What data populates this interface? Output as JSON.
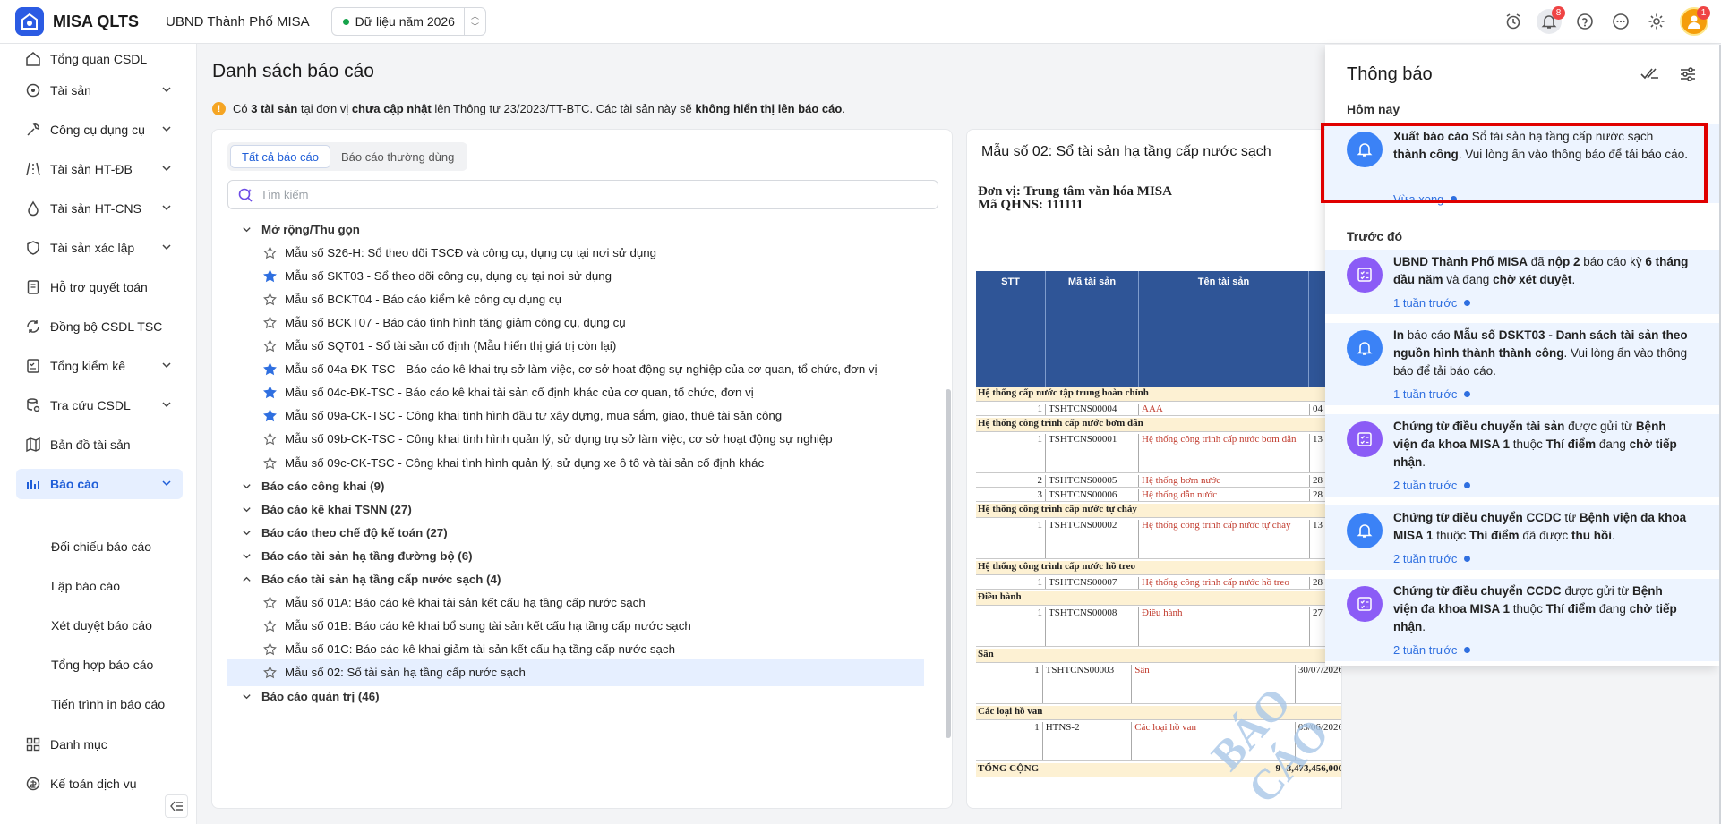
{
  "app": {
    "name": "MISA QLTS",
    "org": "UBND Thành Phố MISA",
    "year_label": "Dữ liệu năm 2026"
  },
  "topbar": {
    "notif_count": "8",
    "avatar_count": "1"
  },
  "sidebar": {
    "items": [
      {
        "label": "Tổng quan CSDL",
        "icon": "home-icon"
      },
      {
        "label": "Tài sản",
        "icon": "assets-icon"
      },
      {
        "label": "Công cụ dụng cụ",
        "icon": "tools-icon"
      },
      {
        "label": "Tài sản HT-ĐB",
        "icon": "road-icon"
      },
      {
        "label": "Tài sản HT-CNS",
        "icon": "water-icon"
      },
      {
        "label": "Tài sản xác lập",
        "icon": "shield-icon"
      },
      {
        "label": "Hỗ trợ quyết toán",
        "icon": "doc-icon"
      },
      {
        "label": "Đồng bộ CSDL TSC",
        "icon": "sync-icon"
      },
      {
        "label": "Tổng kiểm kê",
        "icon": "checklist-icon"
      },
      {
        "label": "Tra cứu CSDL",
        "icon": "search-db-icon"
      },
      {
        "label": "Bản đồ tài sản",
        "icon": "map-icon"
      },
      {
        "label": "Báo cáo",
        "icon": "report-icon"
      }
    ],
    "sub_items": [
      "Đối chiếu báo cáo",
      "Lập báo cáo",
      "Xét duyệt báo cáo",
      "Tổng hợp báo cáo",
      "Tiến trình in báo cáo"
    ],
    "bottom_items": [
      {
        "label": "Danh mục",
        "icon": "grid-icon"
      },
      {
        "label": "Kế toán dịch vụ",
        "icon": "accounting-icon"
      }
    ]
  },
  "main": {
    "title": "Danh sách báo cáo",
    "warning": {
      "a": "Có ",
      "b": "3 tài sản",
      "c": " tại đơn vị ",
      "d": "chưa cập nhật",
      "e": " lên Thông tư 23/2023/TT-BTC. Các tài sản này sẽ ",
      "f": "không hiển thị lên báo cáo",
      "g": "."
    },
    "tabs": [
      "Tất cả báo cáo",
      "Báo cáo thường dùng"
    ],
    "search_placeholder": "Tìm kiếm",
    "tree": [
      {
        "type": "group",
        "label": "Mở rộng/Thu gọn",
        "open": true
      },
      {
        "type": "leaf",
        "label": "Mẫu số S26-H: Sổ theo dõi TSCĐ và công cụ, dụng cụ tại nơi sử dụng",
        "starred": false
      },
      {
        "type": "leaf",
        "label": "Mẫu số SKT03 - Sổ theo dõi công cụ, dụng cụ tại nơi sử dụng",
        "starred": true
      },
      {
        "type": "leaf",
        "label": "Mẫu số BCKT04 - Báo cáo kiểm kê công cụ dụng cụ",
        "starred": false
      },
      {
        "type": "leaf",
        "label": "Mẫu số BCKT07 - Báo cáo tình hình tăng giảm công cụ, dụng cụ",
        "starred": false
      },
      {
        "type": "leaf",
        "label": "Mẫu số SQT01 - Sổ tài sản cố định (Mẫu hiển thị giá trị còn lại)",
        "starred": false
      },
      {
        "type": "leaf",
        "label": "Mẫu số 04a-ĐK-TSC - Báo cáo kê khai trụ sở làm việc, cơ sở hoạt động sự nghiệp của cơ quan, tổ chức, đơn vị",
        "starred": true
      },
      {
        "type": "leaf",
        "label": "Mẫu số 04c-ĐK-TSC - Báo cáo kê khai tài sản cố định khác của cơ quan, tổ chức, đơn vị",
        "starred": true
      },
      {
        "type": "leaf",
        "label": "Mẫu số 09a-CK-TSC - Công khai tình hình đầu tư xây dựng, mua sắm, giao, thuê tài sản công",
        "starred": true
      },
      {
        "type": "leaf",
        "label": "Mẫu số 09b-CK-TSC - Công khai tình hình quản lý, sử dụng trụ sở làm việc, cơ sở hoạt động sự nghiệp",
        "starred": false
      },
      {
        "type": "leaf",
        "label": "Mẫu số 09c-CK-TSC - Công khai tình hình quản lý, sử dụng xe ô tô và tài sản cố định khác",
        "starred": false
      },
      {
        "type": "group",
        "label": "Báo cáo công khai (9)",
        "open": false
      },
      {
        "type": "group",
        "label": "Báo cáo kê khai TSNN (27)",
        "open": false
      },
      {
        "type": "group",
        "label": "Báo cáo theo chế độ kế toán (27)",
        "open": false
      },
      {
        "type": "group",
        "label": "Báo cáo tài sản hạ tầng đường bộ (6)",
        "open": false
      },
      {
        "type": "group",
        "label": "Báo cáo tài sản hạ tầng cấp nước sạch (4)",
        "open": true
      },
      {
        "type": "leaf",
        "label": "Mẫu số 01A: Báo cáo kê khai tài sản kết cấu hạ tầng cấp nước sạch",
        "starred": false
      },
      {
        "type": "leaf",
        "label": "Mẫu số 01B: Báo cáo kê khai bổ sung tài sản kết cấu hạ tầng cấp nước sạch",
        "starred": false
      },
      {
        "type": "leaf",
        "label": "Mẫu số 01C: Báo cáo kê khai giảm tài sản kết cấu hạ tầng cấp nước sạch",
        "starred": false
      },
      {
        "type": "leaf",
        "label": "Mẫu số 02: Sổ tài sản hạ tầng cấp nước sạch",
        "starred": false,
        "selected": true
      },
      {
        "type": "group",
        "label": "Báo cáo quản trị (46)",
        "open": false
      }
    ]
  },
  "preview": {
    "title": "Mẫu số 02: Sổ tài sản hạ tầng cấp nước sạch",
    "unit_line1": "Đơn vị: Trung tâm văn hóa MISA",
    "unit_line2": "Mã QHNS: 111111",
    "headers": [
      "STT",
      "Mã tài sản",
      "Tên tài sản"
    ],
    "rows": [
      {
        "g": true,
        "t": "Hệ thống cấp nước tập trung hoàn chỉnh"
      },
      {
        "g": false,
        "stt": "1",
        "code": "TSHTCNS00004",
        "name": "AAA",
        "extra": "04"
      },
      {
        "g": true,
        "t": "Hệ thống công trình cấp nước bơm dẫn"
      },
      {
        "g": false,
        "stt": "1",
        "code": "TSHTCNS00001",
        "name": "Hệ thống công trình cấp nước bơm dẫn",
        "extra": "13",
        "tall": true
      },
      {
        "g": false,
        "stt": "2",
        "code": "TSHTCNS00005",
        "name": "Hệ thống bơm nước",
        "extra": "28"
      },
      {
        "g": false,
        "stt": "3",
        "code": "TSHTCNS00006",
        "name": "Hệ thống dẫn nước",
        "extra": "28"
      },
      {
        "g": true,
        "t": "Hệ thống công trình cấp nước tự chảy"
      },
      {
        "g": false,
        "stt": "1",
        "code": "TSHTCNS00002",
        "name": "Hệ thống công trình cấp nước tự chảy",
        "extra": "13",
        "tall": true
      },
      {
        "g": true,
        "t": "Hệ thống công trình cấp nước hồ treo"
      },
      {
        "g": false,
        "stt": "1",
        "code": "TSHTCNS00007",
        "name": "Hệ thống công trình cấp nước hồ treo",
        "extra": "28"
      },
      {
        "g": true,
        "t": "Điều hành"
      },
      {
        "g": false,
        "stt": "1",
        "code": "TSHTCNS00008",
        "name": "Điều hành",
        "extra": "27",
        "tall": true
      },
      {
        "g": true,
        "t": "Sân"
      },
      {
        "g": false,
        "stt": "1",
        "code": "TSHTCNS00003",
        "name": "Sân",
        "extra": "30/07/2026",
        "tall": true
      },
      {
        "g": true,
        "t": "Các loại hồ van"
      },
      {
        "g": false,
        "stt": "1",
        "code": "HTNS-2",
        "name": "Các loại hồ van",
        "extra": "03/06/2026",
        "tall": true
      },
      {
        "g": true,
        "t": "TỔNG CỘNG",
        "total": "3,473,456,000",
        "count": "9"
      }
    ],
    "watermark": "BÁO CÁO"
  },
  "notifications": {
    "title": "Thông báo",
    "today_label": "Hôm nay",
    "earlier_label": "Trước đó",
    "today": [
      {
        "icon": "bell",
        "parts": [
          [
            "b",
            "Xuất báo cáo"
          ],
          [
            "t",
            " Sổ tài sản hạ tầng cấp nước sạch "
          ],
          [
            "b",
            "thành công"
          ],
          [
            "t",
            ". Vui lòng ấn vào thông báo để tải báo cáo."
          ]
        ],
        "time": "Vừa xong"
      }
    ],
    "earlier": [
      {
        "icon": "task",
        "parts": [
          [
            "b",
            "UBND Thành Phố MISA"
          ],
          [
            "t",
            " đã "
          ],
          [
            "b",
            "nộp 2"
          ],
          [
            "t",
            " báo cáo kỳ "
          ],
          [
            "b",
            "6 tháng đầu năm"
          ],
          [
            "t",
            " và đang "
          ],
          [
            "b",
            "chờ xét duyệt"
          ],
          [
            "t",
            "."
          ]
        ],
        "time": "1 tuần trước"
      },
      {
        "icon": "bell",
        "parts": [
          [
            "b",
            "In"
          ],
          [
            "t",
            " báo cáo "
          ],
          [
            "b",
            "Mẫu số DSKT03 - Danh sách tài sản theo nguồn hình thành thành công"
          ],
          [
            "t",
            ". Vui lòng ấn vào thông báo để tải báo cáo."
          ]
        ],
        "time": "1 tuần trước"
      },
      {
        "icon": "task",
        "parts": [
          [
            "b",
            "Chứng từ điều chuyển tài sản"
          ],
          [
            "t",
            " được gửi từ "
          ],
          [
            "b",
            "Bệnh viện đa khoa MISA 1"
          ],
          [
            "t",
            " thuộc "
          ],
          [
            "b",
            "Thí điểm"
          ],
          [
            "t",
            " đang "
          ],
          [
            "b",
            "chờ tiếp nhận"
          ],
          [
            "t",
            "."
          ]
        ],
        "time": "2 tuần trước"
      },
      {
        "icon": "bell",
        "parts": [
          [
            "b",
            "Chứng từ điều chuyển CCDC"
          ],
          [
            "t",
            " từ "
          ],
          [
            "b",
            "Bệnh viện đa khoa MISA 1"
          ],
          [
            "t",
            " thuộc "
          ],
          [
            "b",
            "Thí điểm"
          ],
          [
            "t",
            " đã được "
          ],
          [
            "b",
            "thu hồi"
          ],
          [
            "t",
            "."
          ]
        ],
        "time": "2 tuần trước"
      },
      {
        "icon": "task",
        "parts": [
          [
            "b",
            "Chứng từ điều chuyển CCDC"
          ],
          [
            "t",
            " được gửi từ "
          ],
          [
            "b",
            "Bệnh viện đa khoa MISA 1"
          ],
          [
            "t",
            " thuộc "
          ],
          [
            "b",
            "Thí điểm"
          ],
          [
            "t",
            " đang "
          ],
          [
            "b",
            "chờ tiếp nhận"
          ],
          [
            "t",
            "."
          ]
        ],
        "time": "2 tuần trước"
      }
    ]
  }
}
